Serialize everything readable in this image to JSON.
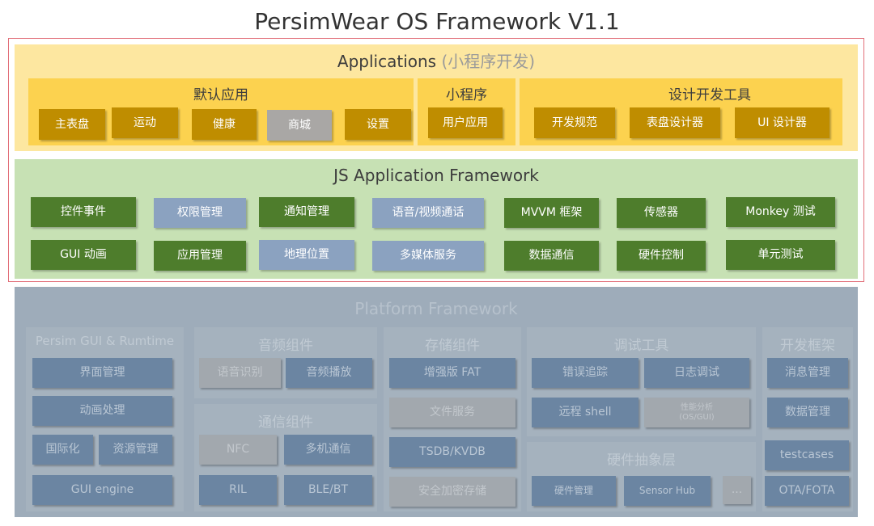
{
  "title": "PersimWear OS Framework V1.1",
  "applications": {
    "label": "Applications",
    "label_note": "(小程序开发)",
    "groups": [
      {
        "label": "默认应用",
        "items": [
          "主表盘",
          "运动",
          "健康",
          "商城",
          "设置"
        ]
      },
      {
        "label": "小程序",
        "items": [
          "用户应用"
        ]
      },
      {
        "label": "设计开发工具",
        "items": [
          "开发规范",
          "表盘设计器",
          "UI 设计器"
        ]
      }
    ]
  },
  "js_framework": {
    "label": "JS Application Framework",
    "row1": [
      "控件事件",
      "权限管理",
      "通知管理",
      "语音/视频通话",
      "MVVM 框架",
      "传感器",
      "Monkey 测试"
    ],
    "row2": [
      "GUI 动画",
      "应用管理",
      "地理位置",
      "多媒体服务",
      "数据通信",
      "硬件控制",
      "单元测试"
    ]
  },
  "platform": {
    "label": "Platform Framework",
    "gui": {
      "label": "Persim GUI & Rumtime",
      "items": [
        "界面管理",
        "动画处理",
        "国际化",
        "资源管理",
        "GUI engine"
      ]
    },
    "audio": {
      "label": "音频组件",
      "items": [
        "语音识别",
        "音频播放"
      ]
    },
    "comm": {
      "label": "通信组件",
      "items": [
        "NFC",
        "多机通信",
        "RIL",
        "BLE/BT"
      ]
    },
    "storage": {
      "label": "存储组件",
      "items": [
        "增强版 FAT",
        "文件服务",
        "TSDB/KVDB",
        "安全加密存储"
      ]
    },
    "debug": {
      "label": "调试工具",
      "items": [
        "错误追踪",
        "日志调试",
        "远程 shell",
        "性能分析\n(OS/GUI)"
      ]
    },
    "hal": {
      "label": "硬件抽象层",
      "items": [
        "硬件管理",
        "Sensor Hub",
        "..."
      ]
    },
    "devfw": {
      "label": "开发框架",
      "items": [
        "消息管理",
        "数据管理",
        "testcases",
        "OTA/FOTA"
      ]
    }
  },
  "colors": {
    "apps_band": "#fde7a0",
    "apps_group": "#fcd24f",
    "apps_box": "#bf8d00",
    "apps_box_gray": "#a9a7a5",
    "fw_band": "#c7e1b4",
    "fw_green": "#4e7d2c",
    "fw_blue": "#8ba2c0",
    "platform_band": "#9eacba",
    "highlight_frame": "#e2707a"
  }
}
